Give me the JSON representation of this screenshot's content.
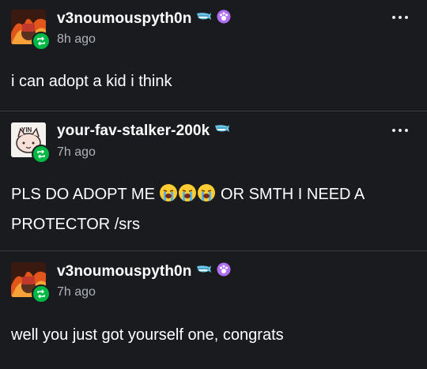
{
  "posts": [
    {
      "username": "v3noumouspyth0n",
      "time": "8h ago",
      "text": "i can adopt a kid i think",
      "badges": [
        "whale-badge-icon",
        "paw-badge-icon"
      ],
      "avatar": "fire-avatar"
    },
    {
      "username": "your-fav-stalker-200k",
      "time": "7h ago",
      "text_before": "PLS DO ADOPT ME ",
      "text_after": " OR SMTH I NEED A PROTECTOR /srs",
      "emojis": [
        "loudly-crying-face-icon",
        "loudly-crying-face-icon",
        "loudly-crying-face-icon"
      ],
      "badges": [
        "whale-badge-icon"
      ],
      "avatar": "yin-cat-avatar",
      "avatar_text": "YIN"
    },
    {
      "username": "v3noumouspyth0n",
      "time": "7h ago",
      "text": "well you just got yourself one, congrats",
      "badges": [
        "whale-badge-icon",
        "paw-badge-icon"
      ],
      "avatar": "fire-avatar"
    }
  ],
  "colors": {
    "background": "#191b1e",
    "reblog_green": "#00b846",
    "divider": "#3a3c40",
    "timestamp": "#b0b3b8",
    "badge_purple": "#b06ef0"
  }
}
